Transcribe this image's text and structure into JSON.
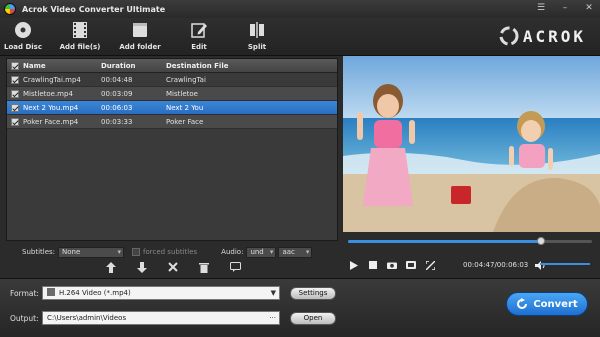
{
  "window": {
    "title": "Acrok Video Converter Ultimate",
    "brand": "ACROK"
  },
  "toolbar": {
    "load_disc": "Load Disc",
    "add_files": "Add file(s)",
    "add_folder": "Add folder",
    "edit": "Edit",
    "split": "Split"
  },
  "file_list": {
    "headers": {
      "name": "Name",
      "duration": "Duration",
      "destination": "Destination File"
    },
    "rows": [
      {
        "name": "CrawlingTai.mp4",
        "duration": "00:04:48",
        "destination": "CrawlingTai",
        "checked": true
      },
      {
        "name": "Mistletoe.mp4",
        "duration": "00:03:09",
        "destination": "Mistletoe",
        "checked": true
      },
      {
        "name": "Next 2 You.mp4",
        "duration": "00:06:03",
        "destination": "Next 2 You",
        "checked": true,
        "selected": true
      },
      {
        "name": "Poker Face.mp4",
        "duration": "00:03:33",
        "destination": "Poker Face",
        "checked": true
      }
    ]
  },
  "subtitles": {
    "label": "Subtitles:",
    "value": "None",
    "forced_label": "forced subtitles",
    "audio_label": "Audio:",
    "audio_lang": "und",
    "audio_codec": "aac"
  },
  "player": {
    "time": "00:04:47/00:06:03",
    "progress": 0.79,
    "volume": 1.0
  },
  "output": {
    "format_label": "Format:",
    "format_value": "H.264 Video (*.mp4)",
    "settings_label": "Settings",
    "output_label": "Output:",
    "output_path": "C:\\Users\\admin\\Videos",
    "browse_label": "···",
    "open_label": "Open",
    "convert_label": "Convert"
  },
  "colors": {
    "accent": "#2a6ec2",
    "background": "#2b2b2b",
    "convert": "#1e6fd0"
  }
}
